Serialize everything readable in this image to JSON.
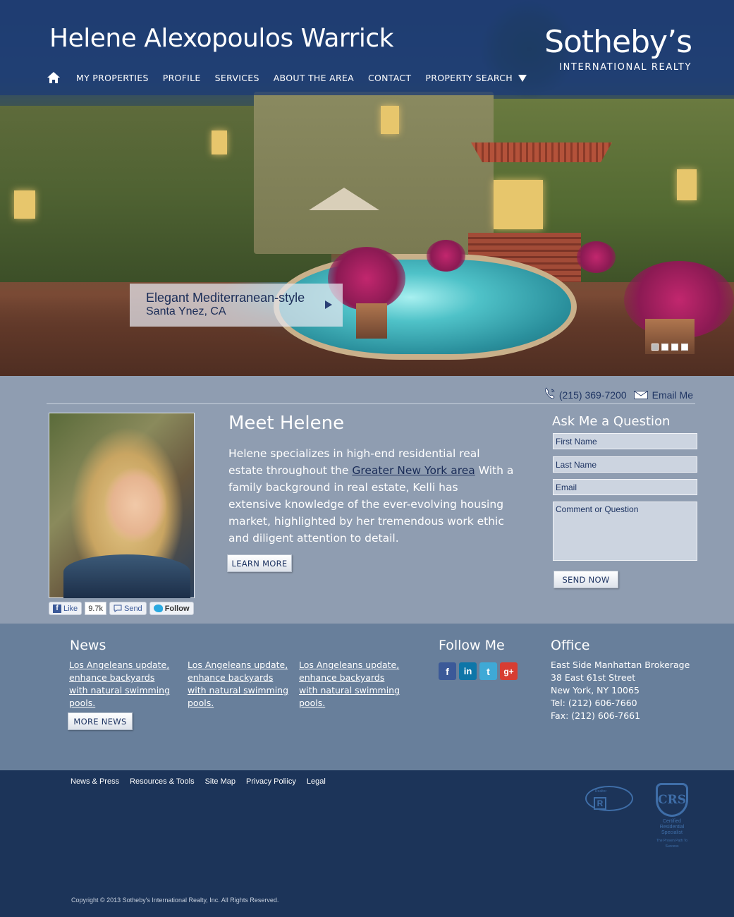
{
  "header": {
    "agent_name": "Helene Alexopoulos Warrick",
    "brand_main": "Sotheby’s",
    "brand_sub": "INTERNATIONAL REALTY",
    "nav": [
      {
        "label": "MY PROPERTIES"
      },
      {
        "label": "PROFILE"
      },
      {
        "label": "SERVICES"
      },
      {
        "label": "ABOUT THE AREA"
      },
      {
        "label": "CONTACT"
      },
      {
        "label": "PROPERTY SEARCH"
      }
    ]
  },
  "hero": {
    "caption_title": "Elegant Mediterranean-style",
    "caption_location": "Santa Ynez, CA",
    "slide_count": 4,
    "active_slide": 1
  },
  "contact": {
    "phone": "(215) 369-7200",
    "email_label": "Email Me"
  },
  "meet": {
    "title": "Meet Helene",
    "text_before": "Helene specializes in high-end residential real estate throughout the ",
    "link": "Greater New York area",
    "text_after": " With a family background in real estate, Kelli has extensive knowledge of the ever-evolving housing market, highlighted by her tremendous work ethic and diligent attention to detail.",
    "learn_more": "LEARN MORE"
  },
  "social": {
    "like": "Like",
    "like_count": "9.7k",
    "send": "Send",
    "follow": "Follow"
  },
  "ask": {
    "title": "Ask Me a Question",
    "first_name": "First Name",
    "last_name": "Last Name",
    "email": "Email",
    "comment": "Comment or Question",
    "send": "SEND NOW"
  },
  "news": {
    "title": "News",
    "items": [
      "Los Angeleans update, enhance backyards with natural swimming pools.",
      "Los Angeleans update, enhance backyards with natural swimming pools.",
      "Los Angeleans update, enhance backyards with natural swimming pools."
    ],
    "more": "MORE NEWS"
  },
  "follow": {
    "title": "Follow Me",
    "icons": [
      "facebook-icon",
      "linkedin-icon",
      "twitter-icon",
      "google-plus-icon"
    ],
    "colors": {
      "facebook": "#3b5998",
      "linkedin": "#0e76a8",
      "twitter": "#3fa9d6",
      "google": "#d73d32"
    }
  },
  "office": {
    "title": "Office",
    "name": "East Side Manhattan Brokerage",
    "street": "38 East 61st Street",
    "city": "New York, NY  10065",
    "tel": "Tel: (212) 606-7660",
    "fax": "Fax: (212) 606-7661"
  },
  "footer": {
    "links": [
      "News & Press",
      "Resources & Tools",
      "Site Map",
      "Privacy Poliicy",
      "Legal"
    ],
    "copyright": "Copyright © 2013 Sotheby's International Realty, Inc. All Rights Reserved.",
    "crs_label": "CRS",
    "crs_text": "Certified Residential Specialist",
    "crs_tagline": "The Proven Path To Success",
    "realtor_text": "Realtor",
    "realtor_letter": "R"
  },
  "colors": {
    "header_band": "#1e3c73",
    "mid_bg": "#8f9db1",
    "info_bg": "#687f9b",
    "footer_bg": "#1c3459",
    "accent_text": "#1f3563"
  }
}
